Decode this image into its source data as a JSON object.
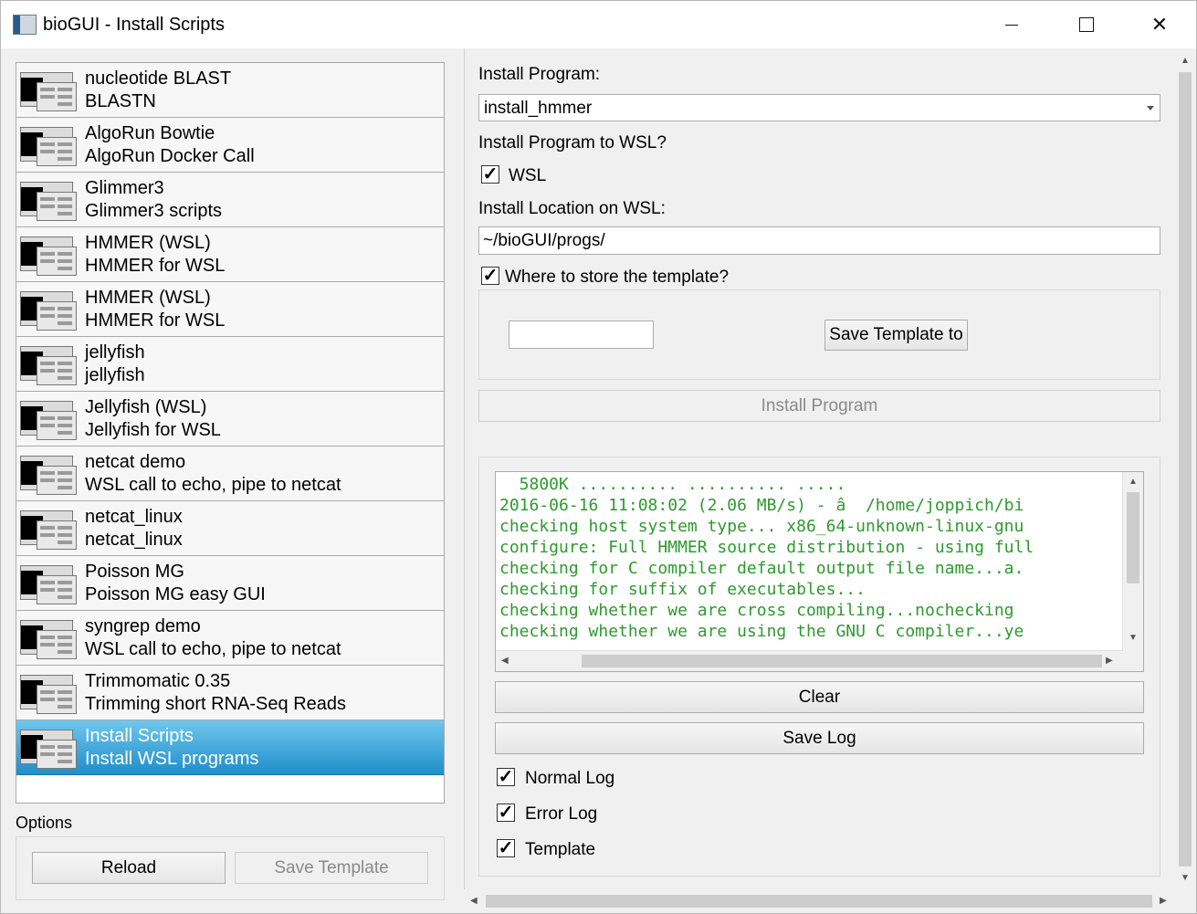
{
  "window": {
    "title": "bioGUI - Install Scripts"
  },
  "scripts": [
    {
      "name": "nucleotide BLAST",
      "desc": "BLASTN"
    },
    {
      "name": "AlgoRun Bowtie",
      "desc": "AlgoRun Docker Call"
    },
    {
      "name": "Glimmer3",
      "desc": "Glimmer3 scripts"
    },
    {
      "name": "HMMER (WSL)",
      "desc": "HMMER for WSL"
    },
    {
      "name": "HMMER (WSL)",
      "desc": "HMMER for WSL"
    },
    {
      "name": "jellyfish",
      "desc": "jellyfish"
    },
    {
      "name": "Jellyfish (WSL)",
      "desc": "Jellyfish for WSL"
    },
    {
      "name": "netcat demo",
      "desc": "WSL call to echo, pipe to netcat"
    },
    {
      "name": "netcat_linux",
      "desc": "netcat_linux"
    },
    {
      "name": "Poisson MG",
      "desc": "Poisson MG easy GUI"
    },
    {
      "name": "syngrep demo",
      "desc": "WSL call to echo, pipe to netcat"
    },
    {
      "name": "Trimmomatic 0.35",
      "desc": "Trimming short RNA-Seq Reads"
    },
    {
      "name": "Install Scripts",
      "desc": "Install WSL programs",
      "selected": true
    }
  ],
  "options": {
    "label": "Options",
    "reload": "Reload",
    "save_template": "Save Template"
  },
  "form": {
    "install_program_label": "Install Program:",
    "install_program_value": "install_hmmer",
    "wsl_question": "Install Program to WSL?",
    "wsl_checkbox": "WSL",
    "wsl_checked": true,
    "location_label": "Install Location on WSL:",
    "location_value": "~/bioGUI/progs/",
    "template_checkbox": "Where to store the template?",
    "template_path": "",
    "save_template_to": "Save Template to",
    "install_button": "Install Program"
  },
  "log": {
    "lines": [
      "  5800K .......... .......... .....",
      "2016-06-16 11:08:02 (2.06 MB/s) - â  /home/joppich/bi",
      "checking host system type... x86_64-unknown-linux-gnu",
      "configure: Full HMMER source distribution - using full",
      "checking for C compiler default output file name...a.",
      "checking for suffix of executables...",
      "checking whether we are cross compiling...nochecking",
      "checking whether we are using the GNU C compiler...ye"
    ],
    "clear": "Clear",
    "save_log": "Save Log",
    "normal_log": "Normal Log",
    "error_log": "Error Log",
    "template": "Template",
    "text_color": "#2e9a2e"
  }
}
